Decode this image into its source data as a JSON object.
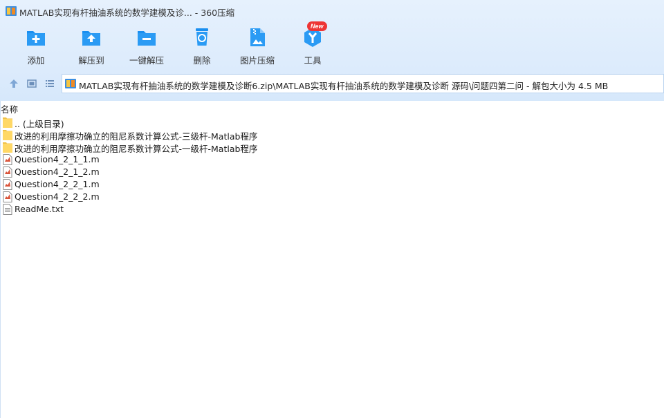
{
  "window": {
    "title": "MATLAB实现有杆抽油系统的数学建模及诊...  - 360压缩"
  },
  "toolbar": {
    "buttons": [
      {
        "label": "添加",
        "icon": "add-folder-icon"
      },
      {
        "label": "解压到",
        "icon": "extract-to-icon"
      },
      {
        "label": "一键解压",
        "icon": "one-click-extract-icon"
      },
      {
        "label": "删除",
        "icon": "delete-trash-icon"
      },
      {
        "label": "图片压缩",
        "icon": "image-compress-icon"
      },
      {
        "label": "工具",
        "icon": "tools-icon",
        "badge": "New"
      }
    ]
  },
  "nav": {
    "address": "MATLAB实现有杆抽油系统的数学建模及诊断6.zip\\MATLAB实现有杆抽油系统的数学建模及诊断 源码\\问题四第二问 - 解包大小为 4.5 MB"
  },
  "list": {
    "column_name": "名称",
    "items": [
      {
        "name": ".. (上级目录)",
        "type": "folder"
      },
      {
        "name": "改进的利用摩擦功确立的阻尼系数计算公式-三级杆-Matlab程序",
        "type": "folder"
      },
      {
        "name": "改进的利用摩擦功确立的阻尼系数计算公式-一级杆-Matlab程序",
        "type": "folder"
      },
      {
        "name": "Question4_2_1_1.m",
        "type": "m-file"
      },
      {
        "name": "Question4_2_1_2.m",
        "type": "m-file"
      },
      {
        "name": "Question4_2_2_1.m",
        "type": "m-file"
      },
      {
        "name": "Question4_2_2_2.m",
        "type": "m-file"
      },
      {
        "name": "ReadMe.txt",
        "type": "text-file"
      }
    ]
  },
  "colors": {
    "header_bg": "#dcebfc",
    "icon_blue": "#1a8ff0",
    "badge_red": "#ee3535",
    "folder_yellow": "#ffd866"
  }
}
